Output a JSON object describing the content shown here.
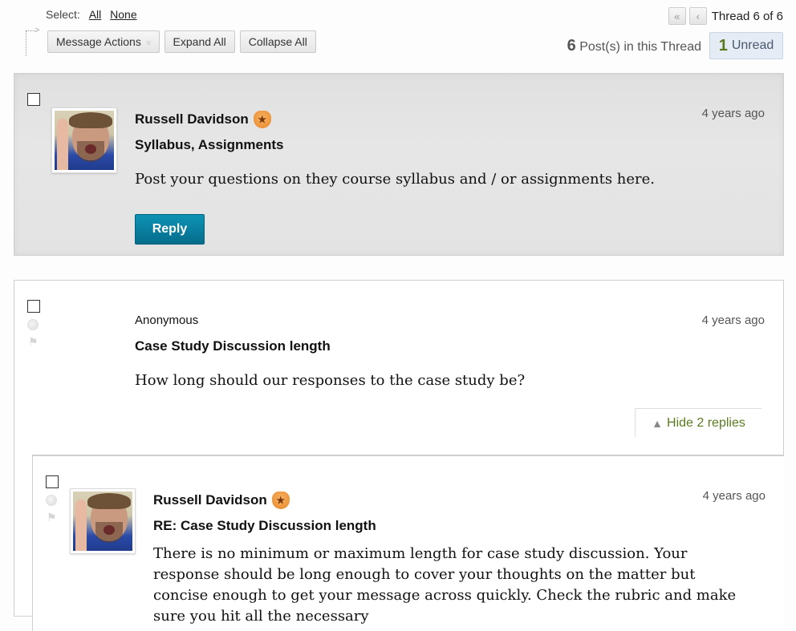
{
  "toolbar": {
    "select_label": "Select:",
    "select_all": "All",
    "select_none": "None",
    "message_actions": "Message Actions",
    "expand_all": "Expand All",
    "collapse_all": "Collapse All"
  },
  "thread_nav": {
    "first_icon": "«",
    "prev_icon": "‹",
    "label": "Thread 6 of 6"
  },
  "thread_stats": {
    "post_count": "6",
    "post_count_label": "Post(s) in this Thread",
    "unread_count": "1",
    "unread_label": "Unread"
  },
  "posts": [
    {
      "author": "Russell Davidson",
      "author_badge_icon": "★",
      "subject": "Syllabus, Assignments",
      "timestamp": "4 years ago",
      "body": "Post your questions on they course syllabus and / or assignments here.",
      "reply_label": "Reply"
    },
    {
      "author": "Anonymous",
      "subject": "Case Study Discussion length",
      "timestamp": "4 years ago",
      "body": "How long should our responses to the case study be?",
      "flag_icon": "⚑",
      "toggle_replies_icon": "▲",
      "toggle_replies_label": "Hide 2 replies"
    },
    {
      "author": "Russell Davidson",
      "author_badge_icon": "★",
      "subject": "RE: Case Study Discussion length",
      "timestamp": "4 years ago",
      "flag_icon": "⚑",
      "body": "There is no minimum or maximum length for case study discussion. Your response should be long enough to cover your thoughts on the matter but concise enough to get your message across quickly. Check the rubric and make sure you hit all the necessary"
    }
  ],
  "colors": {
    "reply_button": "#0a7fa0",
    "unread_accent": "#5b7a1f",
    "unread_bg": "#e5ecf5",
    "main_post_bg": "#e3e3e3"
  }
}
